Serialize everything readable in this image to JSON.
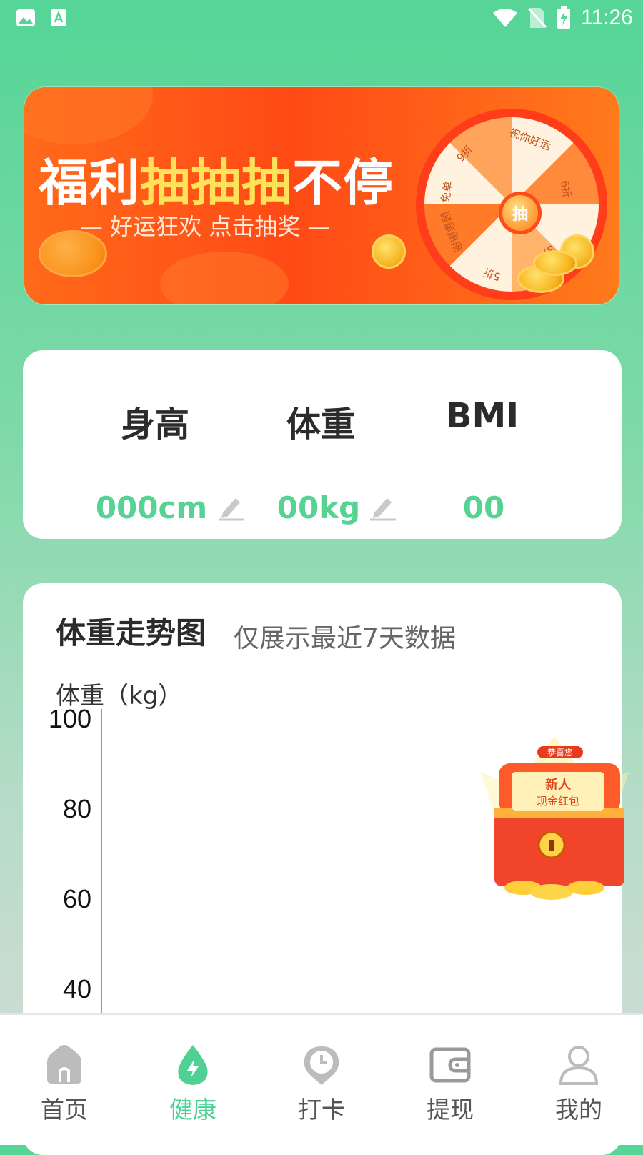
{
  "status_bar": {
    "time": "11:26",
    "left_icons": [
      "gallery-icon",
      "text-app-icon"
    ],
    "right_icons": [
      "wifi-icon",
      "no-sim-icon",
      "battery-charging-icon"
    ]
  },
  "banner": {
    "title_prefix": "福利",
    "title_highlight": "抽抽抽",
    "title_suffix": "不停",
    "subtitle": "— 好运狂欢 点击抽奖 —",
    "wheel_center": "抽",
    "wheel_labels": [
      "祝你好运",
      "9折",
      "6折",
      "免单",
      "8折",
      "谢谢惠顾",
      "5折"
    ]
  },
  "metrics": {
    "height_label": "身高",
    "weight_label": "体重",
    "bmi_label": "BMI",
    "height_value": "000cm",
    "weight_value": "00kg",
    "bmi_value": "00"
  },
  "chart_card": {
    "title": "体重走势图",
    "subtitle": "仅展示最近7天数据"
  },
  "chart_data": {
    "type": "line",
    "title": "体重走势图",
    "subtitle": "仅展示最近7天数据",
    "ylabel": "体重（kg）",
    "xlabel": "",
    "yticks": [
      "100",
      "80",
      "60",
      "40"
    ],
    "ylim": [
      40,
      100
    ],
    "series": []
  },
  "gift": {
    "top_tag": "恭喜您",
    "line1": "新人",
    "line2": "现金红包"
  },
  "nav": {
    "items": [
      {
        "label": "首页",
        "icon": "home-icon"
      },
      {
        "label": "健康",
        "icon": "health-drop-icon"
      },
      {
        "label": "打卡",
        "icon": "clock-pin-icon"
      },
      {
        "label": "提现",
        "icon": "wallet-icon"
      },
      {
        "label": "我的",
        "icon": "user-icon"
      }
    ],
    "active_index": 1
  },
  "colors": {
    "accent_green": "#4fd193",
    "banner_orange": "#ff5a16",
    "highlight_yellow": "#ffe15a"
  }
}
